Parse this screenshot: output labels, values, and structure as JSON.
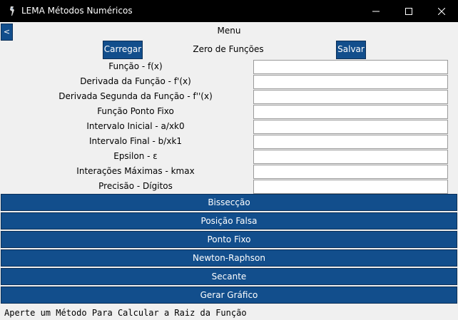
{
  "window": {
    "title": "LEMA Métodos Numéricos",
    "icon": "python-feather-icon"
  },
  "header": {
    "back_label": "<",
    "menu_label": "Menu",
    "load_label": "Carregar",
    "section_title": "Zero de Funções",
    "save_label": "Salvar"
  },
  "form": {
    "fields": [
      {
        "label": "Função - f(x)",
        "value": ""
      },
      {
        "label": "Derivada da Função - f'(x)",
        "value": ""
      },
      {
        "label": "Derivada Segunda da Função - f''(x)",
        "value": ""
      },
      {
        "label": "Função Ponto Fixo",
        "value": ""
      },
      {
        "label": "Intervalo Inicial - a/xk0",
        "value": ""
      },
      {
        "label": "Intervalo Final - b/xk1",
        "value": ""
      },
      {
        "label": "Epsilon - ε",
        "value": ""
      },
      {
        "label": "Interações Máximas - kmax",
        "value": ""
      },
      {
        "label": "Precisão - Dígitos",
        "value": ""
      }
    ]
  },
  "methods": [
    {
      "label": "Bissecção"
    },
    {
      "label": "Posição Falsa"
    },
    {
      "label": "Ponto Fixo"
    },
    {
      "label": "Newton-Raphson"
    },
    {
      "label": "Secante"
    },
    {
      "label": "Gerar Gráfico"
    }
  ],
  "status": {
    "text": "Aperte um Método Para Calcular a Raiz da Função"
  },
  "colors": {
    "button_blue": "#124e8c",
    "titlebar": "#000000",
    "background": "#f0f0f0"
  }
}
